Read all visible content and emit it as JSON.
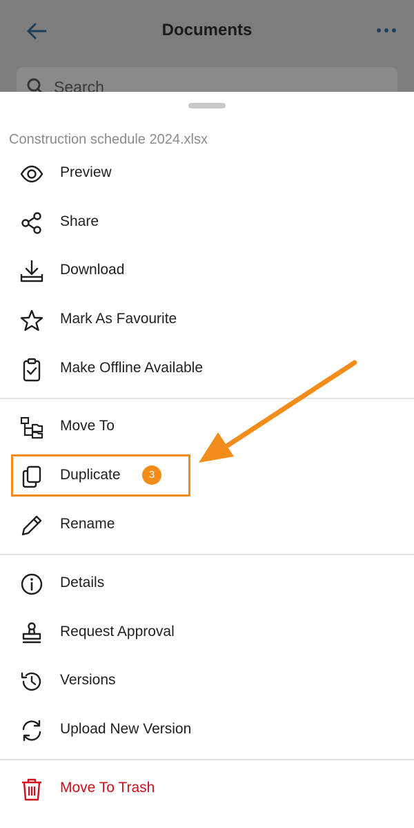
{
  "background": {
    "title": "Documents",
    "search_placeholder": "Search",
    "icons": {
      "back": "arrow-left-icon",
      "more": "more-horizontal-icon",
      "search": "search-icon"
    }
  },
  "sheet": {
    "file_name": "Construction schedule 2024.xlsx",
    "items": [
      {
        "label": "Preview",
        "icon": "eye-icon"
      },
      {
        "label": "Share",
        "icon": "share-icon"
      },
      {
        "label": "Download",
        "icon": "download-icon"
      },
      {
        "label": "Mark As Favourite",
        "icon": "star-icon"
      },
      {
        "label": "Make Offline Available",
        "icon": "clipboard-check-icon"
      },
      {
        "label": "Move To",
        "icon": "folder-tree-icon"
      },
      {
        "label": "Duplicate",
        "icon": "copy-icon"
      },
      {
        "label": "Rename",
        "icon": "pencil-icon"
      },
      {
        "label": "Details",
        "icon": "info-icon"
      },
      {
        "label": "Request Approval",
        "icon": "stamp-icon"
      },
      {
        "label": "Versions",
        "icon": "history-icon"
      },
      {
        "label": "Upload New Version",
        "icon": "refresh-icon"
      },
      {
        "label": "Move To Trash",
        "icon": "trash-icon"
      }
    ]
  },
  "annotation": {
    "step_badge": "3",
    "accent_color": "#f28c1a"
  },
  "colors": {
    "danger": "#d0101b",
    "text": "#1f1f1f",
    "muted": "#8b8b8b"
  }
}
